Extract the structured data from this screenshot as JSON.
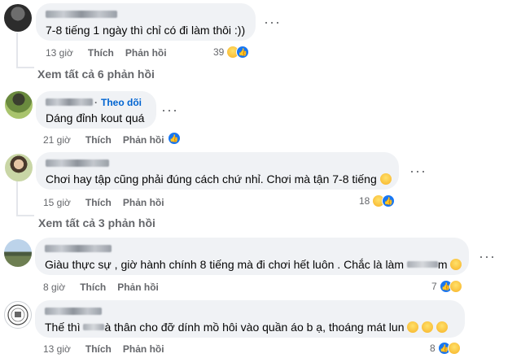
{
  "comments": [
    {
      "text": "7-8 tiếng 1 ngày thì chỉ có đi làm thôi :))",
      "time": "13 giờ",
      "like_label": "Thích",
      "reply_label": "Phản hồi",
      "reaction_count": "39",
      "reactions": [
        "haha-icon",
        "like-icon"
      ]
    },
    {
      "follow_label": "Theo dõi",
      "text": "Dáng đỉnh kout quá",
      "time": "21 giờ",
      "like_label": "Thích",
      "reply_label": "Phản hồi",
      "reactions": [
        "like-icon"
      ]
    },
    {
      "text": "Chơi hay tập cũng phải đúng cách chứ nhỉ. Chơi mà tận 7-8 tiếng",
      "time": "15 giờ",
      "like_label": "Thích",
      "reply_label": "Phản hồi",
      "reaction_count": "18",
      "reactions": [
        "haha-icon",
        "like-icon"
      ]
    },
    {
      "text_before": "Giàu thực sự , giờ hành chính 8 tiếng mà đi chơi hết luôn . Chắc là làm",
      "text_after": "m",
      "time": "8 giờ",
      "like_label": "Thích",
      "reply_label": "Phản hồi",
      "reaction_count": "7",
      "reactions": [
        "like-icon",
        "haha-icon"
      ]
    },
    {
      "text_before": "Thế thì",
      "text_after": "à thân cho đỡ dính mồ hôi vào quần áo b ạ, thoáng mát lun",
      "time": "13 giờ",
      "like_label": "Thích",
      "reply_label": "Phản hồi",
      "reaction_count": "8",
      "reactions": [
        "like-icon",
        "haha-icon"
      ]
    }
  ],
  "view_replies": [
    "Xem tất cả 6 phản hồi",
    "Xem tất cả 3 phản hồi"
  ],
  "colors": {
    "bubble": "#f0f2f5",
    "meta_text": "#65676b",
    "link_blue": "#0064d1",
    "like_blue": "#1877f2",
    "haha_yellow": "#f7b125"
  }
}
